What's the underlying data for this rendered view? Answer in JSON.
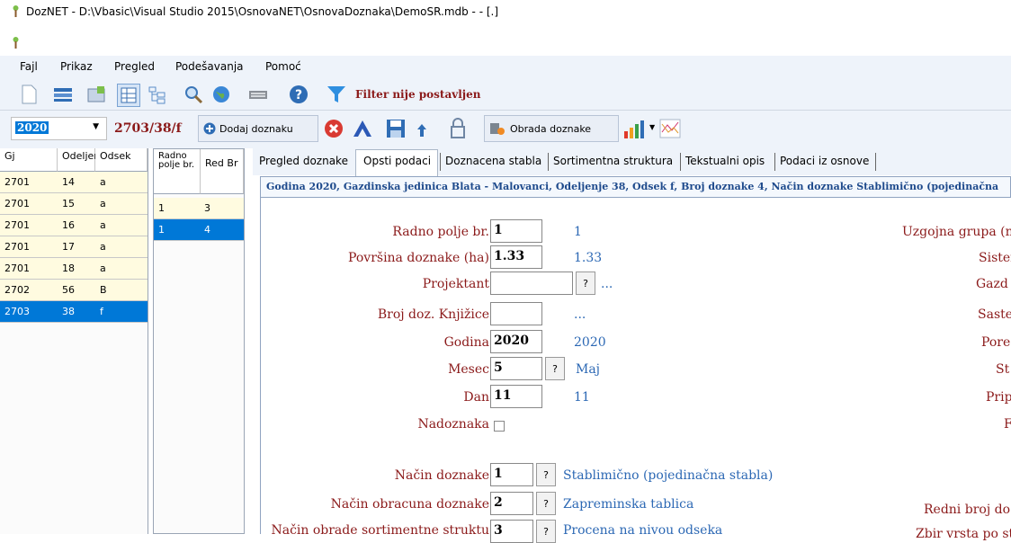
{
  "window": {
    "title": "DozNET - D:\\Vbasic\\Visual Studio 2015\\OsnovaNET\\OsnovaDoznaka\\DemoSR.mdb -  - [.]"
  },
  "menu": [
    "Fajl",
    "Prikaz",
    "Pregled",
    "Podešavanja",
    "Pomoć"
  ],
  "toolbar1": {
    "icons": [
      "new-icon",
      "list-icon",
      "table-icon",
      "grid-icon",
      "tree-icon",
      "search-icon",
      "globe-icon",
      "keyboard-icon",
      "help-icon",
      "filter-icon"
    ],
    "filter_status": "Filter nije postavljen"
  },
  "toolbar2": {
    "year": "2020",
    "doznaka_code": "2703/38/f",
    "add_button": "Dodaj doznaku",
    "process_button": "Obrada doznake"
  },
  "grid_odsek": {
    "headers": [
      "Gj",
      "Odeljer",
      "Odsek"
    ],
    "rows": [
      [
        "2701",
        "14",
        "a"
      ],
      [
        "2701",
        "15",
        "a"
      ],
      [
        "2701",
        "16",
        "a"
      ],
      [
        "2701",
        "17",
        "a"
      ],
      [
        "2701",
        "18",
        "a"
      ],
      [
        "2702",
        "56",
        "B"
      ],
      [
        "2703",
        "38",
        "f"
      ]
    ],
    "selected_index": 6
  },
  "grid_polje": {
    "headers": [
      "Radno polje br.",
      "Red Br"
    ],
    "rows": [
      [
        "1",
        "3"
      ],
      [
        "1",
        "4"
      ]
    ],
    "selected_index": 1
  },
  "tabs": [
    "Pregled doznake",
    "Opsti podaci",
    "Doznacena stabla",
    "Sortimentna struktura",
    "Tekstualni opis",
    "Podaci iz osnove"
  ],
  "active_tab": 1,
  "info_text": "Godina 2020, Gazdinska jedinica Blata - Malovanci, Odeljenje 38, Odsek f, Broj doznake 4, Način doznake Stablimično (pojedinačna",
  "form": {
    "radno_polje": {
      "label": "Radno polje br.",
      "value": "1",
      "display": "1"
    },
    "povrsina": {
      "label": "Površina doznake (ha)",
      "value": "1.33",
      "display": "1.33"
    },
    "projektant": {
      "label": "Projektant",
      "value": "",
      "button": "?",
      "display": "..."
    },
    "broj_knjizice": {
      "label": "Broj doz. Knjižice",
      "value": "",
      "display": "..."
    },
    "godina": {
      "label": "Godina",
      "value": "2020",
      "display": "2020"
    },
    "mesec": {
      "label": "Mesec",
      "value": "5",
      "button": "?",
      "display": "Maj"
    },
    "dan": {
      "label": "Dan",
      "value": "11",
      "display": "11"
    },
    "nadoznaka": {
      "label": "Nadoznaka"
    },
    "nacin_doznake": {
      "label": "Način doznake",
      "value": "1",
      "button": "?",
      "display": "Stablimično (pojedinačna stabla)"
    },
    "nacin_obracuna": {
      "label": "Način obracuna doznake",
      "value": "2",
      "button": "?",
      "display": "Zapreminska tablica"
    },
    "nacin_obrade": {
      "label": "Način obrade sortimentne struktu",
      "value": "3",
      "button": "?",
      "display": "Procena na nivou odseka"
    }
  },
  "right_labels": [
    "Uzgojna grupa (n",
    "Sister",
    "Gazd",
    "Saste",
    "Pore",
    "St",
    "Prip",
    "F",
    "Redni broj do",
    "Zbir vrsta po st"
  ]
}
